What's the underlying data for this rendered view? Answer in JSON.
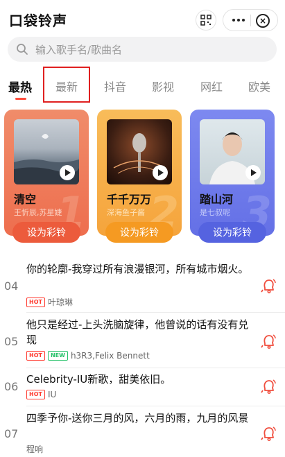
{
  "app": {
    "title": "口袋铃声"
  },
  "search": {
    "placeholder": "输入歌手名/歌曲名"
  },
  "tabs": [
    {
      "label": "最热",
      "active": true
    },
    {
      "label": "最新",
      "active": false
    },
    {
      "label": "抖音",
      "active": false
    },
    {
      "label": "影视",
      "active": false
    },
    {
      "label": "网红",
      "active": false
    },
    {
      "label": "欧美",
      "active": false
    }
  ],
  "featured": [
    {
      "rank": "1",
      "title": "清空",
      "artist": "王忻辰,苏星婕",
      "button": "设为彩铃",
      "color": "#ee7552"
    },
    {
      "rank": "2",
      "title": "千千万万",
      "artist": "深海鱼子酱",
      "button": "设为彩铃",
      "color": "#f5a43c"
    },
    {
      "rank": "3",
      "title": "踏山河",
      "artist": "是七叔呢",
      "button": "设为彩铃",
      "color": "#6a78ea"
    }
  ],
  "songs": [
    {
      "num": "04",
      "title": "你的轮廓-我穿过所有浪漫银河，所有城市烟火。",
      "badges": [
        "HOT"
      ],
      "artist": "叶琼琳"
    },
    {
      "num": "05",
      "title": "他只是经过-上头洗脑旋律，他曾说的话有没有兑现",
      "badges": [
        "HOT",
        "NEW"
      ],
      "artist": "h3R3,Felix Bennett"
    },
    {
      "num": "06",
      "title": "Celebrity-IU新歌，甜美依旧。",
      "badges": [
        "HOT"
      ],
      "artist": "IU"
    },
    {
      "num": "07",
      "title": "四季予你-送你三月的风，六月的雨，九月的风景",
      "badges": [],
      "artist": "程响"
    }
  ],
  "colors": {
    "accent": "#ff4d3d",
    "hot": "#ff3b30",
    "new": "#27c16a"
  }
}
